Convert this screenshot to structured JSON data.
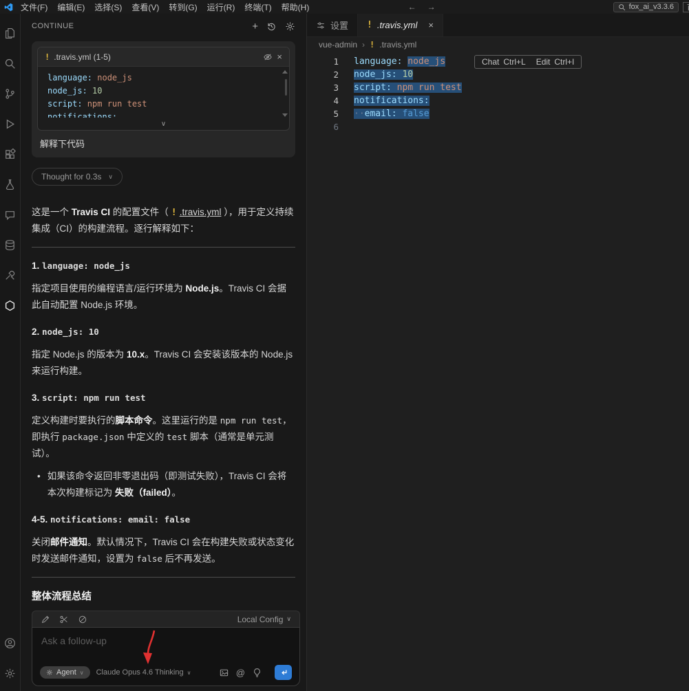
{
  "glyphs": {
    "chevron_down": "∨",
    "close": "×",
    "plus": "+",
    "separator": "›",
    "bullet": "•",
    "back": "←",
    "forward": "→"
  },
  "titlebar": {
    "menus": [
      "文件(F)",
      "编辑(E)",
      "选择(S)",
      "查看(V)",
      "转到(G)",
      "运行(R)",
      "终端(T)",
      "帮助(H)"
    ],
    "search_text": "fox_ai_v3.3.6",
    "partial_button": "首"
  },
  "sidebar": {
    "title": "CONTINUE",
    "user_message": {
      "code_card": {
        "filename": ".travis.yml (1-5)",
        "warning_mark": "!",
        "lines": [
          [
            {
              "t": "key",
              "v": "language:"
            },
            {
              "t": "str",
              "v": " node_js"
            }
          ],
          [
            {
              "t": "key",
              "v": "node_js:"
            },
            {
              "t": "num",
              "v": " 10"
            }
          ],
          [
            {
              "t": "key",
              "v": "script:"
            },
            {
              "t": "str",
              "v": " npm run test"
            }
          ],
          [
            {
              "t": "key",
              "v": "notifications:"
            }
          ]
        ]
      },
      "text": "解释下代码"
    },
    "thought": "Thought for 0.3s",
    "response_blocks": [
      {
        "type": "p",
        "seg": [
          {
            "s": "t",
            "v": "这是一个 "
          },
          {
            "s": "b",
            "v": "Travis CI"
          },
          {
            "s": "t",
            "v": " 的配置文件（ "
          },
          {
            "s": "chip",
            "v": ".travis.yml"
          },
          {
            "s": "t",
            "v": " ），用于定义持续集成（CI）的构建流程。逐行解释如下："
          }
        ]
      },
      {
        "type": "hr"
      },
      {
        "type": "h",
        "seg": [
          {
            "s": "t",
            "v": "1. "
          },
          {
            "s": "c",
            "v": "language: node_js"
          }
        ]
      },
      {
        "type": "p",
        "seg": [
          {
            "s": "t",
            "v": "指定项目使用的编程语言/运行环境为 "
          },
          {
            "s": "b",
            "v": "Node.js"
          },
          {
            "s": "t",
            "v": "。Travis CI 会据此自动配置 Node.js 环境。"
          }
        ]
      },
      {
        "type": "h",
        "seg": [
          {
            "s": "t",
            "v": "2. "
          },
          {
            "s": "c",
            "v": "node_js: 10"
          }
        ]
      },
      {
        "type": "p",
        "seg": [
          {
            "s": "t",
            "v": "指定 Node.js 的版本为 "
          },
          {
            "s": "b",
            "v": "10.x"
          },
          {
            "s": "t",
            "v": "。Travis CI 会安装该版本的 Node.js 来运行构建。"
          }
        ]
      },
      {
        "type": "h",
        "seg": [
          {
            "s": "t",
            "v": "3. "
          },
          {
            "s": "c",
            "v": "script: npm run test"
          }
        ]
      },
      {
        "type": "p",
        "seg": [
          {
            "s": "t",
            "v": "定义构建时要执行的"
          },
          {
            "s": "b",
            "v": "脚本命令"
          },
          {
            "s": "t",
            "v": "。这里运行的是 "
          },
          {
            "s": "c",
            "v": "npm run test"
          },
          {
            "s": "t",
            "v": "，即执行 "
          },
          {
            "s": "c",
            "v": "package.json"
          },
          {
            "s": "t",
            "v": " 中定义的 "
          },
          {
            "s": "c",
            "v": "test"
          },
          {
            "s": "t",
            "v": " 脚本（通常是单元测试）。"
          }
        ]
      },
      {
        "type": "li",
        "seg": [
          {
            "s": "t",
            "v": "如果该命令返回非零退出码（即测试失败），Travis CI 会将本次构建标记为 "
          },
          {
            "s": "b",
            "v": "失败（failed）"
          },
          {
            "s": "t",
            "v": "。"
          }
        ]
      },
      {
        "type": "h",
        "seg": [
          {
            "s": "t",
            "v": "4-5. "
          },
          {
            "s": "c",
            "v": "notifications: email: false"
          }
        ]
      },
      {
        "type": "p",
        "seg": [
          {
            "s": "t",
            "v": "关闭"
          },
          {
            "s": "b",
            "v": "邮件通知"
          },
          {
            "s": "t",
            "v": "。默认情况下，Travis CI 会在构建失败或状态变化时发送邮件通知，设置为 "
          },
          {
            "s": "c",
            "v": "false"
          },
          {
            "s": "t",
            "v": " 后不再发送。"
          }
        ]
      },
      {
        "type": "hr"
      },
      {
        "type": "h2",
        "seg": [
          {
            "s": "t",
            "v": "整体流程总结"
          }
        ]
      }
    ],
    "composer": {
      "local_config": "Local Config",
      "placeholder": "Ask a follow-up",
      "agent": "Agent",
      "model": "Claude Opus 4.6 Thinking",
      "at_sign": "@"
    }
  },
  "editor": {
    "tabs": [
      {
        "label": "设置"
      },
      {
        "label": ".travis.yml",
        "warning_mark": "!"
      }
    ],
    "breadcrumb": {
      "folder": "vue-admin",
      "file": ".travis.yml",
      "warning_mark": "!"
    },
    "hint": {
      "chat": "Chat",
      "chat_key": "Ctrl+L",
      "edit": "Edit",
      "edit_key": "Ctrl+I"
    },
    "lines": [
      {
        "n": 1,
        "seg": [
          {
            "t": "key",
            "v": "language:"
          },
          {
            "t": "plain",
            "v": " "
          },
          {
            "t": "str",
            "v": "node_js",
            "sel": true
          }
        ]
      },
      {
        "n": 2,
        "seg": [
          {
            "t": "key",
            "v": "node_js:",
            "sel": true
          },
          {
            "t": "plain",
            "v": " ",
            "sel": true
          },
          {
            "t": "num",
            "v": "10",
            "sel": true
          }
        ]
      },
      {
        "n": 3,
        "seg": [
          {
            "t": "key",
            "v": "script:",
            "sel": true
          },
          {
            "t": "plain",
            "v": " ",
            "sel": true
          },
          {
            "t": "str",
            "v": "npm run test",
            "sel": true
          }
        ]
      },
      {
        "n": 4,
        "seg": [
          {
            "t": "key",
            "v": "notifications:",
            "sel": true
          }
        ]
      },
      {
        "n": 5,
        "seg": [
          {
            "t": "ws",
            "v": "··",
            "sel": true
          },
          {
            "t": "key",
            "v": "email:",
            "sel": true
          },
          {
            "t": "plain",
            "v": " ",
            "sel": true
          },
          {
            "t": "bool",
            "v": "false",
            "sel": true
          }
        ]
      },
      {
        "n": 6,
        "seg": []
      }
    ]
  },
  "colors": {
    "accent": "#2e7cd6",
    "selection": "#264f78",
    "warning": "#e2b93d",
    "annotation_arrow": "#e03131"
  }
}
